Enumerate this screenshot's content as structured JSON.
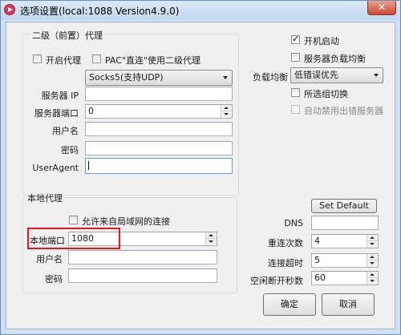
{
  "window": {
    "title": "选项设置(local:1088 Version4.9.0)",
    "close_glyph": "✕"
  },
  "secondary_proxy": {
    "group_title": "二级（前置）代理",
    "enable_label": "开启代理",
    "enable_checked": false,
    "pac_label": "PAC\"直连\"使用二级代理",
    "pac_checked": false,
    "proxy_type": "Socks5(支持UDP)",
    "server_ip_label": "服务器 IP",
    "server_ip_value": "",
    "server_port_label": "服务器端口",
    "server_port_value": "0",
    "username_label": "用户名",
    "username_value": "",
    "password_label": "密码",
    "password_value": "",
    "useragent_label": "UserAgent",
    "useragent_value": ""
  },
  "right_panel": {
    "autostart_label": "开机启动",
    "autostart_checked": true,
    "server_lb_label": "服务器负载均衡",
    "server_lb_checked": false,
    "lb_label": "负载均衡",
    "lb_value": "低错误优先",
    "switch_label": "所选组切换",
    "switch_checked": false,
    "auto_disable_label": "自动禁用出错服务器",
    "auto_disable_checked": false
  },
  "local_proxy": {
    "group_title": "本地代理",
    "allow_lan_label": "允许来自局域网的连接",
    "allow_lan_checked": false,
    "port_label": "本地端口",
    "port_value": "1080",
    "username_label": "用户名",
    "username_value": "",
    "password_label": "密码",
    "password_value": ""
  },
  "advanced": {
    "set_default_label": "Set Default",
    "dns_label": "DNS",
    "dns_value": "",
    "retry_label": "重连次数",
    "retry_value": "4",
    "timeout_label": "连接超时",
    "timeout_value": "5",
    "idle_label": "空闲断开秒数",
    "idle_value": "60"
  },
  "buttons": {
    "ok_label": "确定",
    "cancel_label": "取消"
  },
  "colors": {
    "highlight": "#e8141e",
    "title_bar": "#c2d7ee",
    "close_button": "#c84b34"
  }
}
